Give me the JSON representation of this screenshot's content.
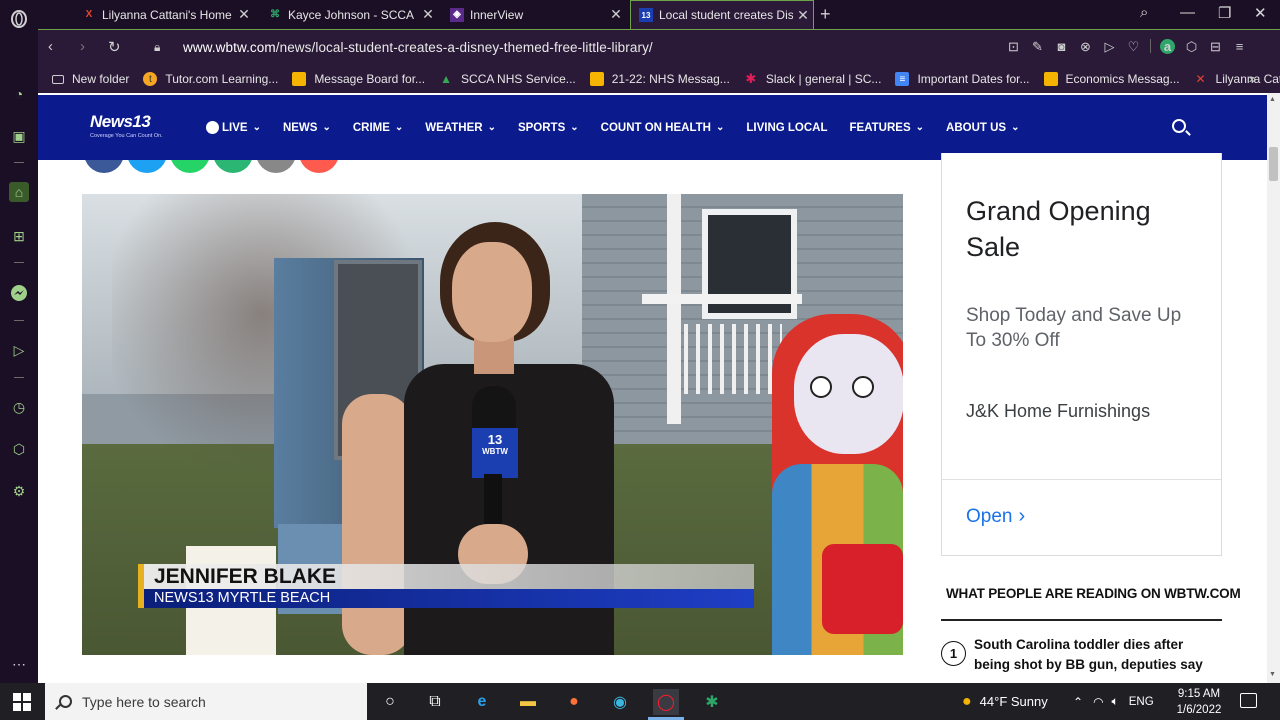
{
  "browser": {
    "tabs": [
      {
        "title": "Lilyanna Cattani's Home Pa",
        "favicon": "X",
        "favicon_color": "#e8432e",
        "active": false
      },
      {
        "title": "Kayce Johnson - SCCA",
        "favicon": "⌘",
        "favicon_color": "#2ea66a",
        "active": false
      },
      {
        "title": "InnerView",
        "favicon": "◈",
        "favicon_color": "#ffffff",
        "active": false
      },
      {
        "title": "Local student creates Disne",
        "favicon": "13",
        "favicon_color": "#1b3fb0",
        "active": true
      }
    ],
    "url_host": "www.wbtw.com",
    "url_path": "/news/local-student-creates-a-disney-themed-free-little-library/",
    "account_initial": "a",
    "bookmarks": [
      {
        "label": "New folder",
        "icon": "folder-icon",
        "color": "#cfcfcf"
      },
      {
        "label": "Tutor.com Learning...",
        "icon": "tutor-icon",
        "color": "#f5a623"
      },
      {
        "label": "Message Board for...",
        "icon": "board-icon",
        "color": "#f4b400"
      },
      {
        "label": "SCCA NHS Service...",
        "icon": "drive-icon",
        "color": "#34a853"
      },
      {
        "label": "21-22: NHS Messag...",
        "icon": "board-icon",
        "color": "#f4b400"
      },
      {
        "label": "Slack | general | SC...",
        "icon": "slack-icon",
        "color": "#e01e5a"
      },
      {
        "label": "Important Dates for...",
        "icon": "docs-icon",
        "color": "#4285f4"
      },
      {
        "label": "Economics Messag...",
        "icon": "board-icon",
        "color": "#f4b400"
      },
      {
        "label": "Lilyanna Cattani's H...",
        "icon": "x-icon",
        "color": "#e8432e"
      }
    ]
  },
  "site": {
    "logo_text": "News13",
    "logo_tagline": "Coverage You Can Count On.",
    "menu": [
      {
        "label": "LIVE",
        "has_dropdown": true
      },
      {
        "label": "NEWS",
        "has_dropdown": true
      },
      {
        "label": "CRIME",
        "has_dropdown": true
      },
      {
        "label": "WEATHER",
        "has_dropdown": true
      },
      {
        "label": "SPORTS",
        "has_dropdown": true
      },
      {
        "label": "COUNT ON HEALTH",
        "has_dropdown": true
      },
      {
        "label": "LIVING LOCAL",
        "has_dropdown": false
      },
      {
        "label": "FEATURES",
        "has_dropdown": true
      },
      {
        "label": "ABOUT US",
        "has_dropdown": true
      }
    ],
    "brand_color": "#0b1a8c",
    "share_colors": [
      "#3b5998",
      "#1da1f2",
      "#25d366",
      "#2bb673",
      "#888888",
      "#ff5a4e"
    ]
  },
  "video": {
    "mic_flag_number": "13",
    "mic_flag_text": "WBTW",
    "lower_third_name": "JENNIFER BLAKE",
    "lower_third_sub": "NEWS13 MYRTLE BEACH"
  },
  "ad": {
    "headline": "Grand Opening Sale",
    "description": "Shop Today and Save Up To 30% Off",
    "brand": "J&K Home Furnishings",
    "cta": "Open",
    "cta_color": "#1a73e8"
  },
  "reading": {
    "title": "WHAT PEOPLE ARE READING ON WBTW.COM",
    "items": [
      {
        "num": "1",
        "text": "South Carolina toddler dies after being shot by BB gun, deputies say"
      }
    ]
  },
  "taskbar": {
    "search_placeholder": "Type here to search",
    "weather": "44°F  Sunny",
    "language": "ENG",
    "time": "9:15 AM",
    "date": "1/6/2022"
  }
}
